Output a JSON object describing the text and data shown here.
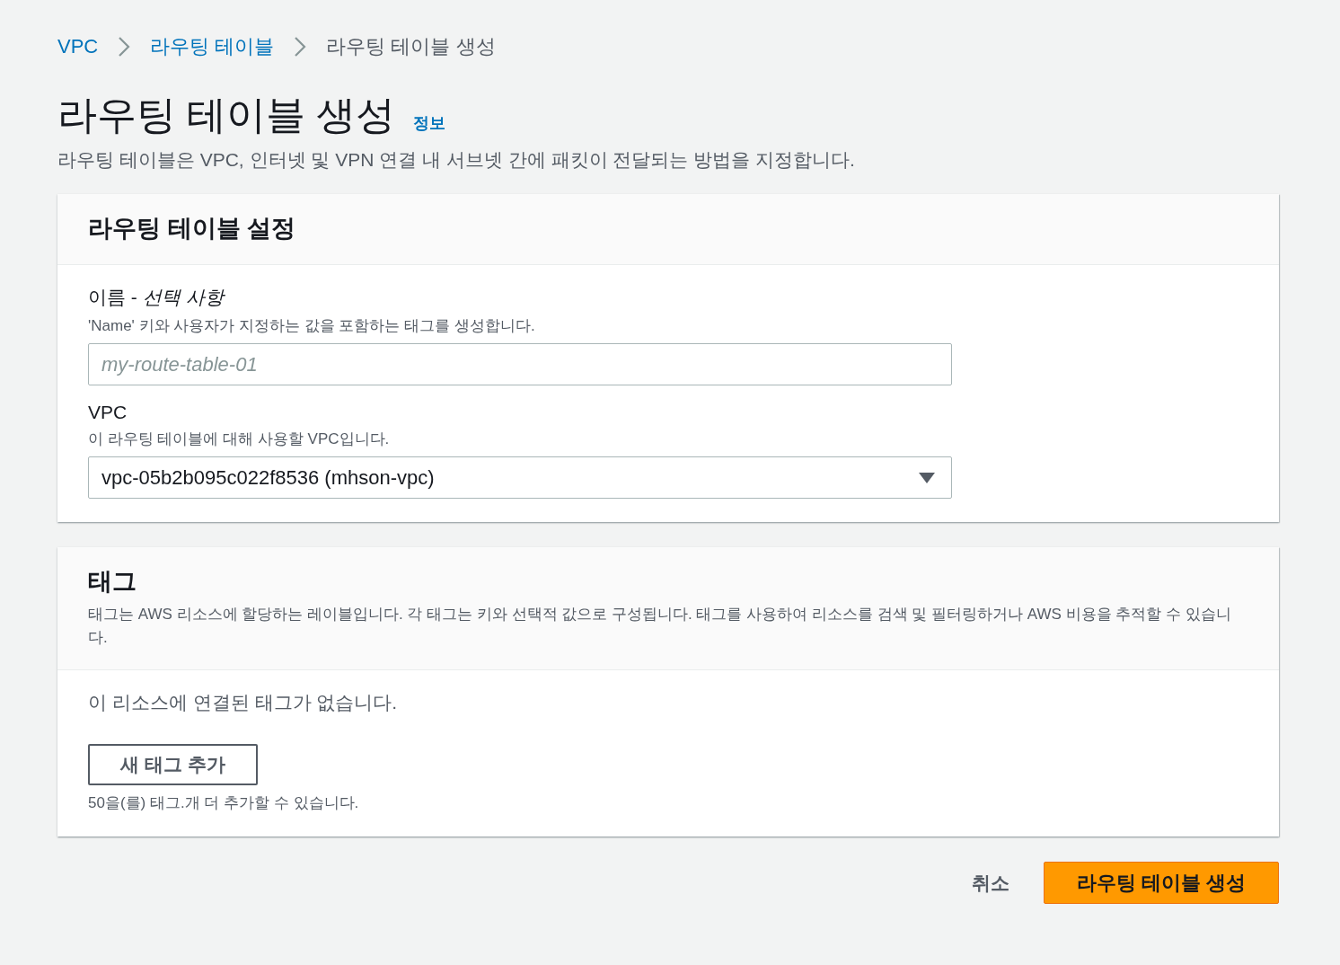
{
  "breadcrumbs": [
    {
      "label": "VPC",
      "link": true
    },
    {
      "label": "라우팅 테이블",
      "link": true
    },
    {
      "label": "라우팅 테이블 생성",
      "link": false
    }
  ],
  "page": {
    "title": "라우팅 테이블 생성",
    "info_link": "정보",
    "description": "라우팅 테이블은 VPC, 인터넷 및 VPN 연결 내 서브넷 간에 패킷이 전달되는 방법을 지정합니다."
  },
  "settings": {
    "title": "라우팅 테이블 설정",
    "name_field": {
      "label": "이름 - *선택 사항*",
      "description": "'Name' 키와 사용자가 지정하는 값을 포함하는 태그를 생성합니다.",
      "placeholder": "my-route-table-01"
    },
    "vpc_field": {
      "label": "VPC",
      "description": "이 라우팅 테이블에 대해 사용할 VPC입니다.",
      "value": "vpc-05b2b095c022f8536 (mhson-vpc)"
    }
  },
  "tags": {
    "title": "태그",
    "description": "태그는 AWS 리소스에 할당하는 레이블입니다. 각 태그는 키와 선택적 값으로 구성됩니다. 태그를 사용하여 리소스를 검색 및 필터링하거나 AWS 비용을 추적할 수 있습니다.",
    "empty_text": "이 리소스에 연결된 태그가 없습니다.",
    "add_button": "새 태그 추가",
    "limit_text": "50을(를) 태그.개 더 추가할 수 있습니다."
  },
  "actions": {
    "cancel": "취소",
    "submit": "라우팅 테이블 생성"
  }
}
